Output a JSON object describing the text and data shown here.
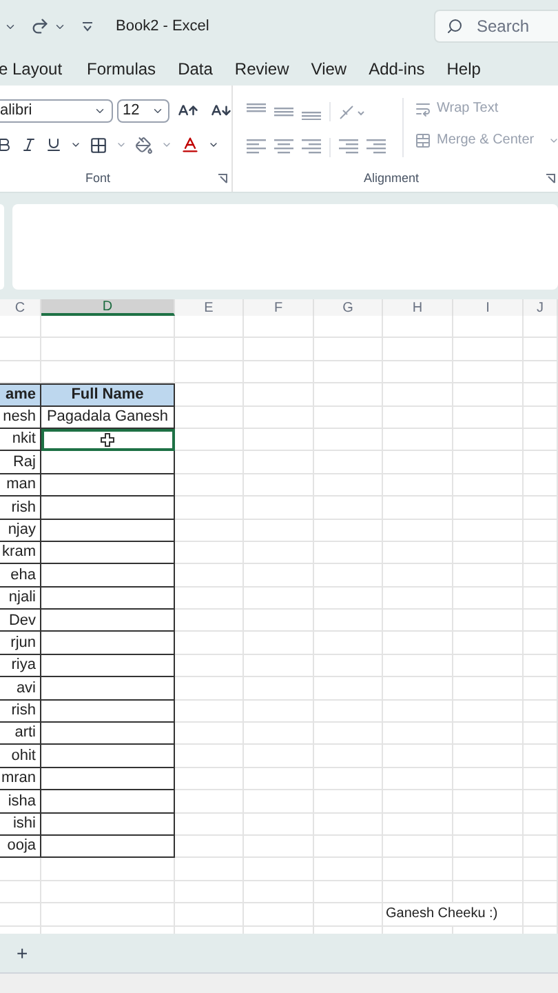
{
  "title_bar": {
    "title": "Book2  -  Excel",
    "search": {
      "placeholder": "Search"
    }
  },
  "menu": [
    {
      "label": "e Layout"
    },
    {
      "label": "Formulas"
    },
    {
      "label": "Data"
    },
    {
      "label": "Review"
    },
    {
      "label": "View"
    },
    {
      "label": "Add-ins"
    },
    {
      "label": "Help"
    }
  ],
  "ribbon": {
    "font": {
      "font_name": "alibri",
      "font_size": "12",
      "label": "Font"
    },
    "alignment": {
      "label": "Alignment",
      "buttons": [
        {
          "label": "Wrap Text",
          "disabled": true
        },
        {
          "label": "Merge & Center",
          "disabled": true
        }
      ]
    }
  },
  "columns": [
    {
      "label": "C",
      "selected": false
    },
    {
      "label": "D",
      "selected": true
    },
    {
      "label": "E",
      "selected": false
    },
    {
      "label": "F",
      "selected": false
    },
    {
      "label": "G",
      "selected": false
    },
    {
      "label": "H",
      "selected": false
    },
    {
      "label": "I",
      "selected": false
    },
    {
      "label": "J",
      "selected": false
    }
  ],
  "table": {
    "headers": [
      "ame",
      "Full Name"
    ],
    "rows": [
      {
        "column_c": "nesh",
        "column_d": "Pagadala Ganesh",
        "selected": false
      },
      {
        "column_c": "nkit",
        "selected": true
      },
      {
        "column_c": "Raj",
        "selected": false
      },
      {
        "column_c": "man",
        "selected": false
      },
      {
        "column_c": "rish",
        "selected": false
      },
      {
        "column_c": "njay",
        "selected": false
      },
      {
        "column_c": "kram",
        "selected": false
      },
      {
        "column_c": "eha",
        "selected": false
      },
      {
        "column_c": "njali",
        "selected": false
      },
      {
        "column_c": "Dev",
        "selected": false
      },
      {
        "column_c": "rjun",
        "selected": false
      },
      {
        "column_c": "riya",
        "selected": false
      },
      {
        "column_c": "avi",
        "selected": false
      },
      {
        "column_c": "rish",
        "selected": false
      },
      {
        "column_c": "arti",
        "selected": false
      },
      {
        "column_c": "ohit",
        "selected": false
      },
      {
        "column_c": "mran",
        "selected": false
      },
      {
        "column_c": "isha",
        "selected": false
      },
      {
        "column_c": "ishi",
        "selected": false
      },
      {
        "column_c": "ooja",
        "selected": false
      }
    ]
  },
  "note": "Ganesh Cheeku :)",
  "add_sheet": "+"
}
